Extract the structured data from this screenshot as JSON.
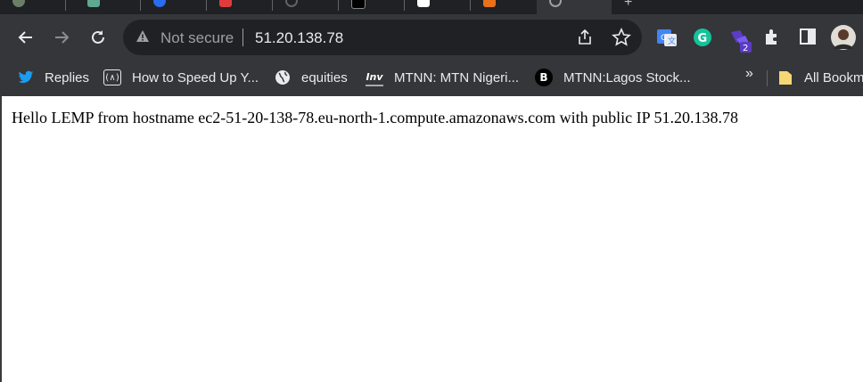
{
  "browser": {
    "security_label": "Not secure",
    "url": "51.20.138.78"
  },
  "tabs": [
    {
      "color": "#6b7f66"
    },
    {
      "color": "#5fa890"
    },
    {
      "color": "#2a6cf0"
    },
    {
      "color": "#e23b3b"
    },
    {
      "color": "#5f6368"
    },
    {
      "color": "#000000"
    },
    {
      "color": "#ffffff"
    },
    {
      "color": "#e8711a"
    },
    {
      "color": "#9aa0a6"
    }
  ],
  "extensions": {
    "badge_count": "2"
  },
  "bookmarks": [
    {
      "label": "Replies",
      "icon": "twitter-icon"
    },
    {
      "label": "How to Speed Up Y...",
      "icon": "code-icon"
    },
    {
      "label": "equities",
      "icon": "globe-icon"
    },
    {
      "label": "MTNN: MTN Nigeri...",
      "icon": "investing-icon"
    },
    {
      "label": "MTNN:Lagos Stock...",
      "icon": "b-icon"
    }
  ],
  "bookmarks_overflow": "»",
  "all_bookmarks_label": "All Bookmarks",
  "page": {
    "text": "Hello LEMP from hostname ec2-51-20-138-78.eu-north-1.compute.amazonaws.com with public IP 51.20.138.78"
  }
}
